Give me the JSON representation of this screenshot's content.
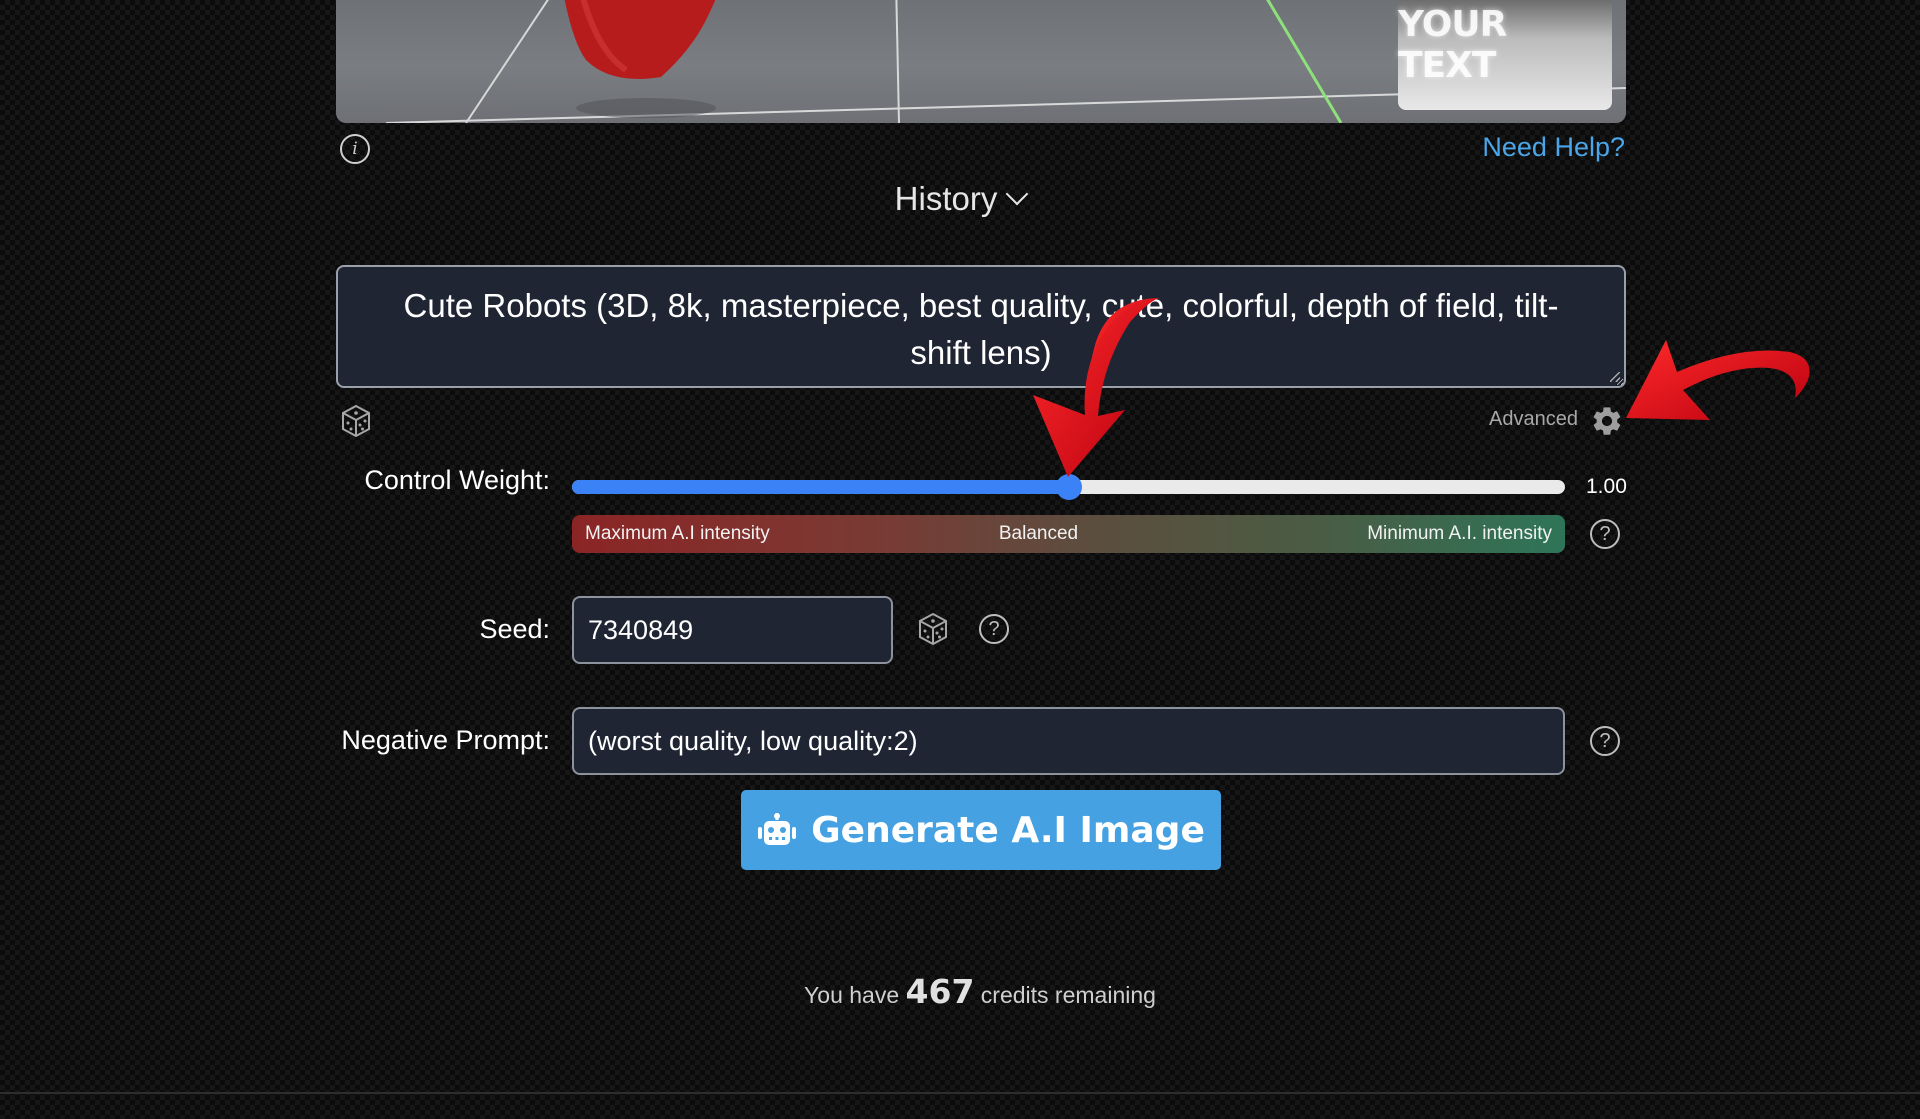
{
  "preview": {
    "thumbnail_text": "YOUR TEXT"
  },
  "header": {
    "info_icon": "info-icon",
    "need_help_label": "Need Help?",
    "history_label": "History"
  },
  "prompt": {
    "value": "Cute Robots (3D, 8k, masterpiece, best quality, cute, colorful, depth of field, tilt-shift lens)"
  },
  "toolbar": {
    "randomize_icon": "dice-icon",
    "advanced_label": "Advanced",
    "advanced_icon": "gear-icon"
  },
  "control_weight": {
    "label": "Control Weight:",
    "value_text": "1.00",
    "position_fraction": 0.5,
    "scale_left": "Maximum A.I intensity",
    "scale_middle": "Balanced",
    "scale_right": "Minimum A.I. intensity",
    "accent_color": "#3b82f6"
  },
  "seed": {
    "label": "Seed:",
    "value": "7340849"
  },
  "negative_prompt": {
    "label": "Negative Prompt:",
    "value": "(worst quality, low quality:2)"
  },
  "generate_button": {
    "label": "Generate A.I Image",
    "icon": "robot-icon",
    "color": "#45a1e2"
  },
  "credits": {
    "prefix": "You have",
    "count": "467",
    "suffix": "credits remaining"
  },
  "annotations": {
    "arrow_color": "#e0141e"
  }
}
